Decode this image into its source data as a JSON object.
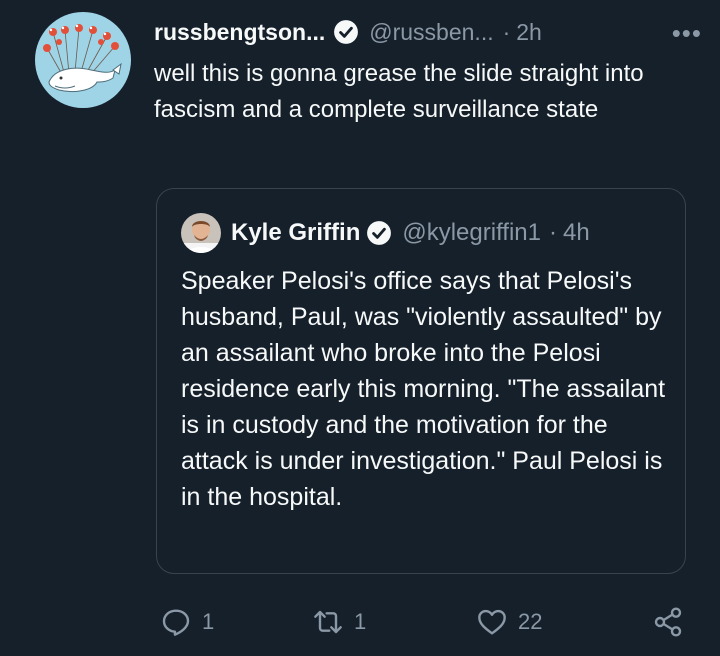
{
  "tweet": {
    "display_name": "russbengtson...",
    "handle": "@russben...",
    "separator": "·",
    "time": "2h",
    "more_label": "•••",
    "text": "well this is gonna grease the slide straight into fascism and a complete surveillance state"
  },
  "quote": {
    "display_name": "Kyle Griffin",
    "handle": "@kylegriffin1",
    "separator": "·",
    "time": "4h",
    "text": "Speaker Pelosi's office says that Pelosi's husband, Paul, was \"violently assaulted\" by an assailant who broke into the Pelosi residence early this morning. \"The assailant is in custody and the motivation for the attack is under investigation.\" Paul Pelosi is in the hospital."
  },
  "actions": {
    "reply_count": "1",
    "retweet_count": "1",
    "like_count": "22"
  },
  "icons": [
    "fail-whale-avatar",
    "verified-icon",
    "more-icon",
    "reply-icon",
    "retweet-icon",
    "like-icon",
    "share-icon"
  ],
  "colors": {
    "background": "#15202b",
    "text": "#f7f9f9",
    "secondary": "#8b98a5",
    "border": "#38444d"
  }
}
